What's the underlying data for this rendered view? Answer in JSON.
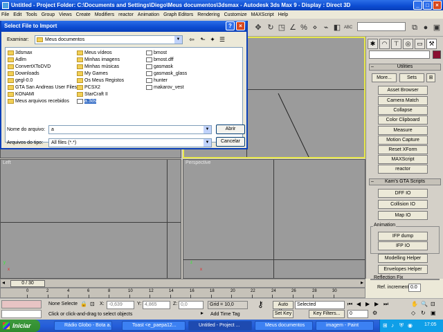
{
  "app": {
    "title": "Untitled    - Project Folder: C:\\Documents and Settings\\Diego\\Meus documentos\\3dsmax    - Autodesk 3ds Max 9    - Display : Direct 3D"
  },
  "menu": [
    "File",
    "Edit",
    "Tools",
    "Group",
    "Views",
    "Create",
    "Modifiers",
    "reactor",
    "Animation",
    "Graph Editors",
    "Rendering",
    "Customize",
    "MAXScript",
    "Help"
  ],
  "toolbar": {
    "view_dropdown": "",
    "abc_label": "ABC"
  },
  "dialog": {
    "title": "Select File to Import",
    "look_in_label": "Examinar:",
    "look_in_value": "Meus documentos",
    "files": [
      {
        "name": "3dsmax",
        "type": "folder"
      },
      {
        "name": "Adlm",
        "type": "folder"
      },
      {
        "name": "ConvertXToDVD",
        "type": "folder"
      },
      {
        "name": "Downloads",
        "type": "folder"
      },
      {
        "name": "gegl-0.0",
        "type": "folder"
      },
      {
        "name": "GTA San Andreas User Files",
        "type": "folder"
      },
      {
        "name": "KONAMI",
        "type": "folder"
      },
      {
        "name": "Meus arquivos recebidos",
        "type": "folder"
      },
      {
        "name": "Meus vídeos",
        "type": "folder"
      },
      {
        "name": "Minhas imagens",
        "type": "folder"
      },
      {
        "name": "Minhas músicas",
        "type": "folder"
      },
      {
        "name": "My Games",
        "type": "folder"
      },
      {
        "name": "Os Meus Registos",
        "type": "folder"
      },
      {
        "name": "PCSX2",
        "type": "folder"
      },
      {
        "name": "StarCraft II",
        "type": "folder"
      },
      {
        "name": "a.3ds",
        "type": "doc",
        "selected": true
      },
      {
        "name": "bmost",
        "type": "doc"
      },
      {
        "name": "bmost.dff",
        "type": "doc"
      },
      {
        "name": "gasmask",
        "type": "doc"
      },
      {
        "name": "gasmask_glass",
        "type": "doc"
      },
      {
        "name": "hunter",
        "type": "doc"
      },
      {
        "name": "makarov_vest",
        "type": "doc"
      }
    ],
    "filename_label": "Nome do arquivo:",
    "filename_value": "a",
    "filetype_label": "Arquivos do tipo:",
    "filetype_value": "All files (*.*)",
    "open_button": "Abrir",
    "cancel_button": "Cancelar"
  },
  "viewports": {
    "left_label": "Left",
    "perspective_label": "Perspective",
    "axis_x": "x",
    "axis_y": "y",
    "axis_z": "z"
  },
  "command_panel": {
    "utilities_header": "Utilities",
    "more_button": "More...",
    "sets_button": "Sets",
    "utility_buttons": [
      "Asset Browser",
      "Camera Match",
      "Collapse",
      "Color Clipboard",
      "Measure",
      "Motion Capture",
      "Reset XForm",
      "MAXScript",
      "reactor"
    ],
    "kams_header": "Kam's GTA Scripts",
    "kams_buttons": [
      "DFF IO",
      "Collision IO",
      "Map IO"
    ],
    "animation_group": "Animation",
    "animation_buttons": [
      "IFP dump",
      "IFP IO"
    ],
    "other_buttons": [
      "Modelling Helper",
      "Envelopes Helper"
    ],
    "reflection_group": "Reflection Fix",
    "ref_increment_label": "Ref. increment",
    "ref_increment_value": "0.0"
  },
  "timeline": {
    "slider_label": "0 / 30",
    "ticks": [
      "0",
      "2",
      "4",
      "6",
      "8",
      "10",
      "12",
      "14",
      "16",
      "18",
      "20",
      "22",
      "24",
      "26",
      "28",
      "30"
    ]
  },
  "status": {
    "selection": "None Selecte",
    "x_label": "X:",
    "x_value": "-0,639",
    "y_label": "Y:",
    "y_value": "4,865",
    "z_label": "Z:",
    "z_value": "0,0",
    "grid": "Grid = 10,0",
    "auto_key": "Auto Key",
    "selected": "Selected",
    "set_key": "Set Key",
    "key_filters": "Key Filters...",
    "frame_value": "0",
    "prompt": "Click or click-and-drag to select objects",
    "add_time_tag": "Add Time Tag"
  },
  "taskbar": {
    "start": "Iniciar",
    "items": [
      "Rádio Globo - Bota a...",
      "Toast <e_paepa12...",
      "Untitled    - Project ...",
      "Meus documentos",
      "imagem - Paint"
    ],
    "clock": "17:05"
  }
}
